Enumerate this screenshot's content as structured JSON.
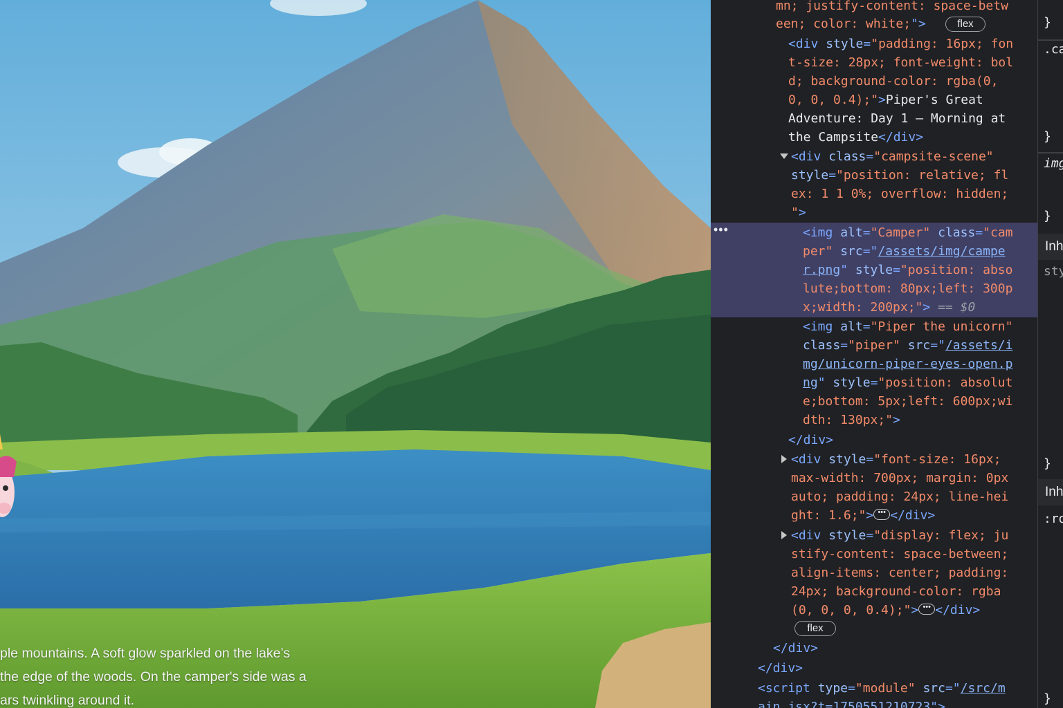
{
  "page": {
    "story_lines": [
      "ple mountains. A soft glow sparkled on the lake’s",
      "the edge of the woods. On the camper's side was a",
      "ars twinkling around it."
    ]
  },
  "devtools": {
    "line0a": "mn; justify-content: space-betw",
    "line0b_attr": "een; color: white;",
    "flex_badge": "flex",
    "title_div": {
      "open": "<div",
      "attr_name": "style",
      "value_lines": [
        "\"padding: 16px; fon",
        "t-size: 28px; font-weight: bol",
        "d; background-color: rgba(0,",
        "0, 0, 0.4);\""
      ],
      "text_1": "Piper's Great",
      "text_2": "Adventure: Day 1 — Morning at",
      "text_3": "the Campsite",
      "close": "</div>"
    },
    "campsite_div": {
      "open": "<div",
      "class_name": "class",
      "class_value": "\"campsite-scene\"",
      "style_name": "style",
      "style_lines": [
        "\"position: relative; fl",
        "ex: 1 1 0%; overflow: hidden;",
        "\""
      ]
    },
    "camper_img": {
      "alt_value": "\"Camper\"",
      "class_value_a": "\"cam",
      "class_value_b": "per\"",
      "src_a": "/assets/img/campe",
      "src_b": "r.png",
      "style_lines": [
        "\"position: abso",
        "lute;bottom: 80px;left: 300p",
        "x;width: 200px;\""
      ],
      "eq": "==",
      "dollar": "$0"
    },
    "piper_img": {
      "alt_value": "\"Piper the unicorn\"",
      "class_value": "\"piper\"",
      "src_a": "/assets/i",
      "src_b": "mg/unicorn-piper-eyes-open.p",
      "src_c": "ng",
      "style_lines": [
        "\"position: absolut",
        "e;bottom: 5px;left: 600px;wi",
        "dth: 130px;\""
      ]
    },
    "close_div": "</div>",
    "story_div": {
      "style_lines": [
        "\"font-size: 16px;",
        "max-width: 700px; margin: 0px",
        "auto; padding: 24px; line-hei",
        "ght: 1.6;\""
      ]
    },
    "footer_div": {
      "style_lines": [
        "\"display: flex; ju",
        "stify-content: space-between;",
        "align-items: center; padding:",
        "24px; background-color: rgba",
        "(0, 0, 0, 0.4);\""
      ]
    },
    "script": {
      "type_value": "\"module\"",
      "src_a": "/src/m",
      "src_b": "ain.jsx?t=1750551210723"
    }
  },
  "styles_pane": {
    "brace": "}",
    "ca": ".ca",
    "img": "img",
    "inh1": "Inh",
    "sty": "sty",
    "inh2": "Inh",
    "ro": ":ro"
  },
  "colors": {
    "panel_bg": "#202124",
    "selected_row": "#404065",
    "tag": "#7aa7ff",
    "attr_value": "#f28b6a"
  }
}
